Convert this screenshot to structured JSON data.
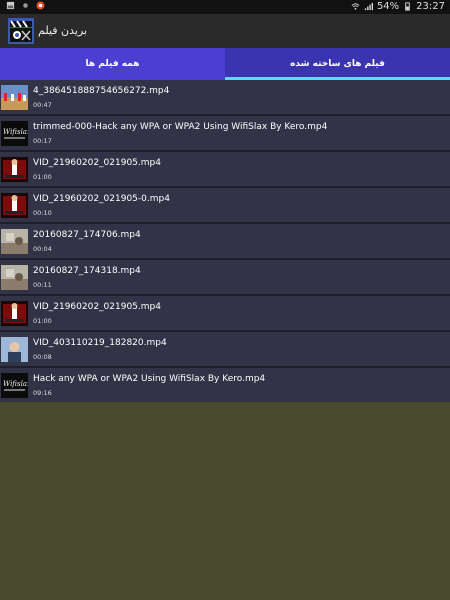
{
  "statusbar": {
    "battery": "54%",
    "time": "23:27"
  },
  "app": {
    "title": "بریدن فیلم"
  },
  "tabs": {
    "all": "همه فیلم ها",
    "made": "فیلم های ساخته شده"
  },
  "videos": [
    {
      "name": "4_386451888754656272.mp4",
      "duration": "00:47",
      "thumb": "sport-thumb"
    },
    {
      "name": "trimmed-000-Hack any WPA or WPA2 Using WifiSlax By Kero.mp4",
      "duration": "00:17",
      "thumb": "wifislax-thumb"
    },
    {
      "name": "VID_21960202_021905.mp4",
      "duration": "01:00",
      "thumb": "red-thumb"
    },
    {
      "name": "VID_21960202_021905-0.mp4",
      "duration": "00:10",
      "thumb": "red-thumb"
    },
    {
      "name": "20160827_174706.mp4",
      "duration": "00:04",
      "thumb": "room-thumb"
    },
    {
      "name": "20160827_174318.mp4",
      "duration": "00:11",
      "thumb": "room-thumb"
    },
    {
      "name": "VID_21960202_021905.mp4",
      "duration": "01:00",
      "thumb": "red-thumb"
    },
    {
      "name": "VID_403110219_182820.mp4",
      "duration": "00:08",
      "thumb": "person-thumb"
    },
    {
      "name": "Hack any WPA or WPA2 Using WifiSlax By Kero.mp4",
      "duration": "09:16",
      "thumb": "wifislax-thumb"
    }
  ]
}
